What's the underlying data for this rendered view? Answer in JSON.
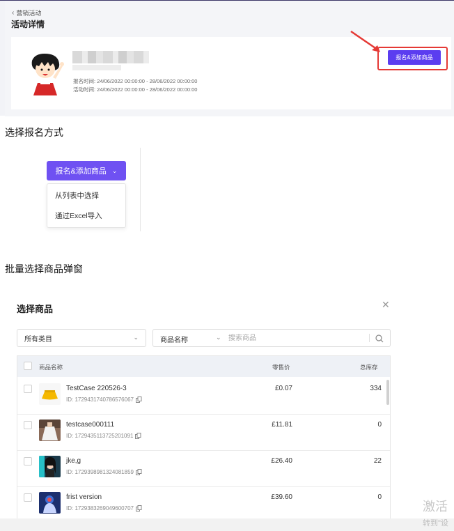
{
  "campaign": {
    "back_label": "营销活动",
    "title": "活动详情",
    "signup_time": "报名时间: 24/06/2022 00:00:00 - 28/06/2022 00:00:00",
    "event_time": "活动时间: 24/06/2022 00:00:00 - 28/06/2022 00:00:00",
    "signup_button": "报名&添加商品",
    "highlight_color": "#e53935",
    "brand_color": "#5b3df0"
  },
  "section2": {
    "heading": "选择报名方式",
    "dropdown_label": "报名&添加商品",
    "menu_items": [
      "从列表中选择",
      "通过Excel导入"
    ]
  },
  "section3": {
    "heading": "批量选择商品弹窗",
    "modal_title": "选择商品",
    "category_select": "所有类目",
    "field_select": "商品名称",
    "search_placeholder": "搜索商品",
    "columns": {
      "name": "商品名称",
      "price": "零售价",
      "stock": "总库存"
    },
    "products": [
      {
        "name": "TestCase 220526-3",
        "id": "ID: 1729431740786576067",
        "price": "£0.07",
        "stock": "334",
        "thumb": "yellow-skirt"
      },
      {
        "name": "testcase000111",
        "id": "ID: 1729435113725201091",
        "price": "£11.81",
        "stock": "0",
        "thumb": "white-dress"
      },
      {
        "name": "jke,g",
        "id": "ID: 1729398981324081859",
        "price": "£26.40",
        "stock": "22",
        "thumb": "portrait-photo"
      },
      {
        "name": "frist version",
        "id": "ID: 1729383269049600707",
        "price": "£39.60",
        "stock": "0",
        "thumb": "blue-figure"
      }
    ]
  },
  "watermark": {
    "line1": "激活",
    "line2": "转到\"设"
  }
}
